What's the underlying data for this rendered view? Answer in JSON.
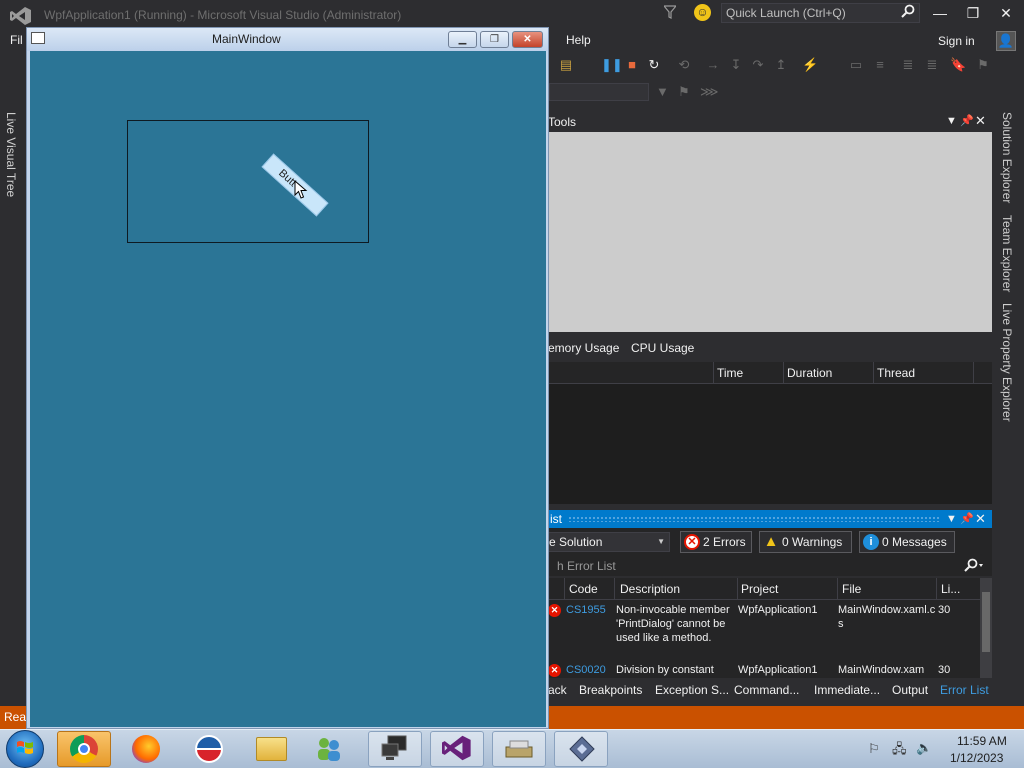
{
  "vs": {
    "title": "WpfApplication1 (Running) - Microsoft Visual Studio (Administrator)",
    "quick_launch_placeholder": "Quick Launch (Ctrl+Q)",
    "menu_file_stub": "Fil",
    "menu_help": "Help",
    "sign_in": "Sign in",
    "left_rail_tab": "Live Visual Tree",
    "right_rail_tabs": [
      "Solution Explorer",
      "Team Explorer",
      "Live Property Explorer"
    ],
    "status": "Rea"
  },
  "diag": {
    "title": "Tools",
    "tabs": [
      "emory Usage",
      "CPU Usage"
    ],
    "columns": [
      "Time",
      "Duration",
      "Thread"
    ]
  },
  "errors": {
    "title": "ist",
    "scope": "e Solution",
    "errors_btn": "2 Errors",
    "warnings_btn": "0 Warnings",
    "messages_btn": "0 Messages",
    "search_placeholder": "h Error List",
    "columns": [
      "Code",
      "Description",
      "Project",
      "File",
      "Li..."
    ],
    "rows": [
      {
        "code": "CS1955",
        "description": "Non-invocable member 'PrintDialog' cannot be used like a method.",
        "project": "WpfApplication1",
        "file": "MainWindow.xaml.cs",
        "line": "30"
      },
      {
        "code": "CS0020",
        "description": "Division by constant",
        "project": "WpfApplication1",
        "file": "MainWindow.xam",
        "line": "30"
      }
    ]
  },
  "bottom_tabs": [
    "ack",
    "Breakpoints",
    "Exception S...",
    "Command...",
    "Immediate...",
    "Output",
    "Error List"
  ],
  "wpf": {
    "title": "MainWindow",
    "button_text": "Butt"
  },
  "taskbar": {
    "apps": [
      "chrome-icon",
      "firefox-icon",
      "obama-logo-icon",
      "explorer-folder-icon",
      "users-icon",
      "remote-desktop-icon",
      "visual-studio-icon",
      "disk-tools-icon",
      "vs-installer-icon"
    ],
    "time": "11:59 AM",
    "date": "1/12/2023"
  },
  "colors": {
    "vs_background": "#2d2d30",
    "vs_accent": "#007acc",
    "status_debugging": "#ca5100",
    "wpf_client": "#2b7596"
  }
}
